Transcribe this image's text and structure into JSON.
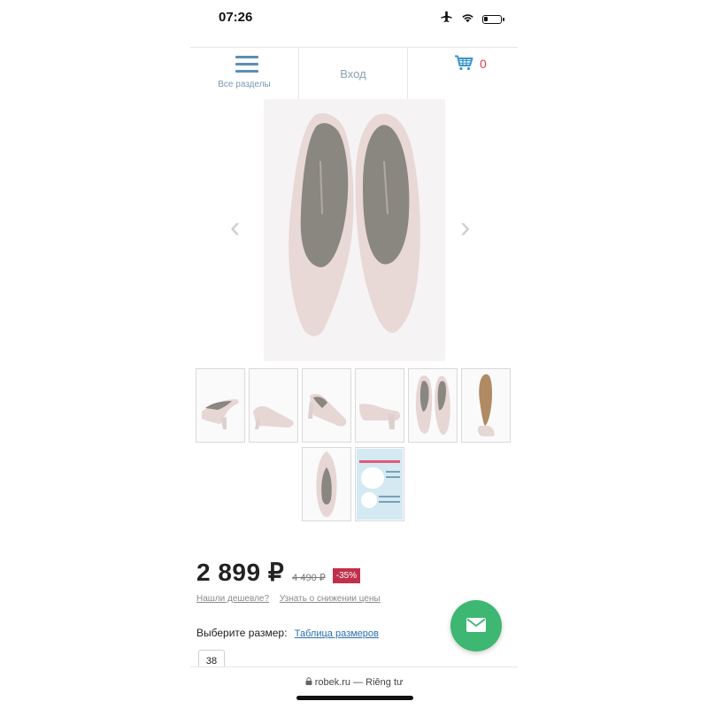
{
  "status_bar": {
    "time": "07:26",
    "icons": [
      "airplane-icon",
      "wifi-icon",
      "battery-icon"
    ],
    "battery_level": 0.25
  },
  "nav": {
    "menu_label": "Все разделы",
    "login_label": "Вход",
    "cart_count": "0"
  },
  "product": {
    "thumbnails_count": 8,
    "price": "2 899 ₽",
    "old_price": "4 490 ₽",
    "discount": "-35%",
    "cheaper_link": "Нашли дешевле?",
    "notify_link": "Узнать о снижении цены",
    "size_prompt": "Выберите размер:",
    "size_table_link": "Таблица размеров",
    "sizes": [
      "38"
    ]
  },
  "browser": {
    "url": "robek.ru — Riêng tư"
  },
  "colors": {
    "accent_blue": "#5a8fb8",
    "cart_red": "#e23c4f",
    "discount_red": "#c0304a",
    "fab_green": "#3db771"
  }
}
